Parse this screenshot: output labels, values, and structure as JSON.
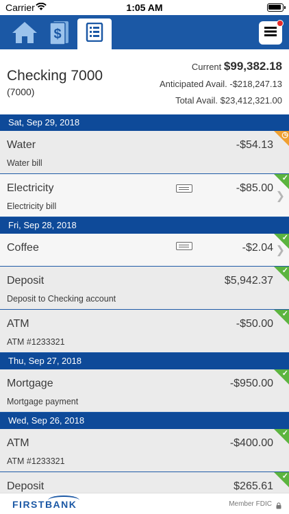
{
  "status_bar": {
    "carrier": "Carrier",
    "time": "1:05 AM"
  },
  "nav": {
    "home_icon": "home-icon",
    "money_icon": "dollar-bill-icon",
    "list_icon": "statement-icon",
    "menu_icon": "hamburger-menu-icon"
  },
  "account": {
    "name": "Checking 7000",
    "number": "(7000)",
    "current_label": "Current",
    "current_value": "$99,382.18",
    "anticipated_label": "Anticipated Avail.",
    "anticipated_value": "-$218,247.13",
    "total_label": "Total Avail.",
    "total_value": "$23,412,321.00"
  },
  "groups": [
    {
      "date": "Sat, Sep 29, 2018",
      "transactions": [
        {
          "name": "Water",
          "description": "Water bill",
          "amount": "-$54.13",
          "status": "pending"
        },
        {
          "name": "Electricity",
          "description": "Electricity bill",
          "amount": "-$85.00",
          "status": "cleared",
          "memo": true,
          "chevron": true
        }
      ]
    },
    {
      "date": "Fri, Sep 28, 2018",
      "transactions": [
        {
          "name": "Coffee",
          "description": "",
          "amount": "-$2.04",
          "status": "cleared",
          "memo": true,
          "chevron": true
        },
        {
          "name": "Deposit",
          "description": "Deposit to Checking account",
          "amount": "$5,942.37",
          "status": "cleared"
        },
        {
          "name": "ATM",
          "description": "ATM #1233321",
          "amount": "-$50.00",
          "status": "cleared"
        }
      ]
    },
    {
      "date": "Thu, Sep 27, 2018",
      "transactions": [
        {
          "name": "Mortgage",
          "description": "Mortgage payment",
          "amount": "-$950.00",
          "status": "cleared"
        }
      ]
    },
    {
      "date": "Wed, Sep 26, 2018",
      "transactions": [
        {
          "name": "ATM",
          "description": "ATM #1233321",
          "amount": "-$400.00",
          "status": "cleared"
        },
        {
          "name": "Deposit",
          "description": "",
          "amount": "$265.61",
          "status": "cleared"
        }
      ]
    }
  ],
  "footer": {
    "logo": "FIRSTBANK",
    "member": "Member FDIC"
  },
  "colors": {
    "brand": "#1b58a5",
    "header": "#0e4a99",
    "cleared": "#5cb43f",
    "pending": "#f0a030",
    "badge": "#e62a2a"
  }
}
